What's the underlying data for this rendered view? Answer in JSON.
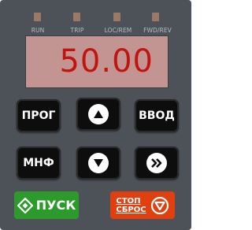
{
  "indicators": [
    {
      "label": "RUN"
    },
    {
      "label": "TRIP"
    },
    {
      "label": "LOC/REM"
    },
    {
      "label": "FWD/REV"
    }
  ],
  "display": {
    "value": "50.00"
  },
  "buttons": {
    "prog_label": "ПРОГ",
    "enter_label": "ВВОД",
    "mnf_label": "МНФ",
    "start_label": "ПУСК",
    "stop_label_top": "СТОП",
    "stop_label_bottom": "СБРОС"
  },
  "icons": {
    "up": "up-arrow-icon",
    "down": "down-arrow-icon",
    "shift": "double-chevron-right-icon",
    "start": "diamond-icon",
    "stop": "down-triangle-circle-icon"
  },
  "colors": {
    "panel": "#4d5258",
    "display_bg": "#c39592",
    "display_text": "#c2130f",
    "start_green": "#2d9b2c",
    "stop_orange": "#e0400f",
    "led": "#9a7a66"
  }
}
